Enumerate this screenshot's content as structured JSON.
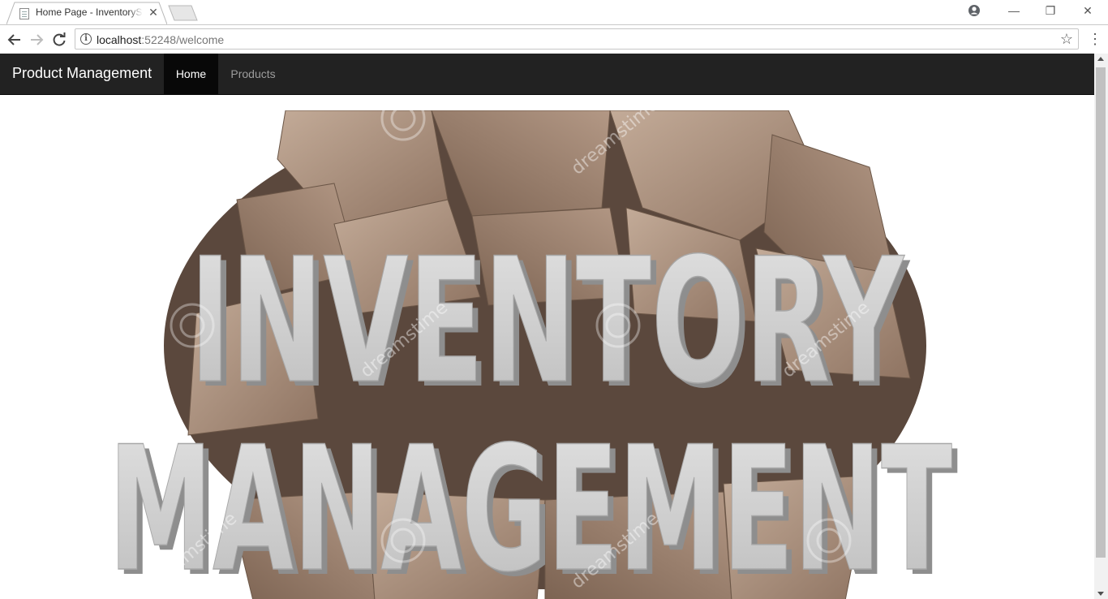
{
  "browser": {
    "tab_title": "Home Page - InventorySystem",
    "tab_close_glyph": "✕",
    "url_host": "localhost",
    "url_path": ":52248/welcome",
    "icons": {
      "favicon": "page-icon",
      "back": "arrow-left-icon",
      "forward": "arrow-right-icon",
      "reload": "reload-icon",
      "info": "info-icon",
      "bookmark": "star-icon",
      "menu": "kebab-menu-icon",
      "account": "account-icon"
    },
    "window_controls": {
      "minimize": "—",
      "maximize": "❐",
      "close": "✕"
    }
  },
  "navbar": {
    "brand": "Product Management",
    "items": [
      {
        "label": "Home",
        "active": true
      },
      {
        "label": "Products",
        "active": false
      }
    ],
    "colors": {
      "background": "#222222",
      "active": "#080808",
      "text": "#9d9d9d"
    }
  },
  "hero": {
    "line1": "INVENTORY",
    "line2": "MANAGEMENT",
    "watermark": "dreamstime",
    "colors": {
      "box": "#a08672",
      "letters": "#c9c9c9"
    }
  }
}
